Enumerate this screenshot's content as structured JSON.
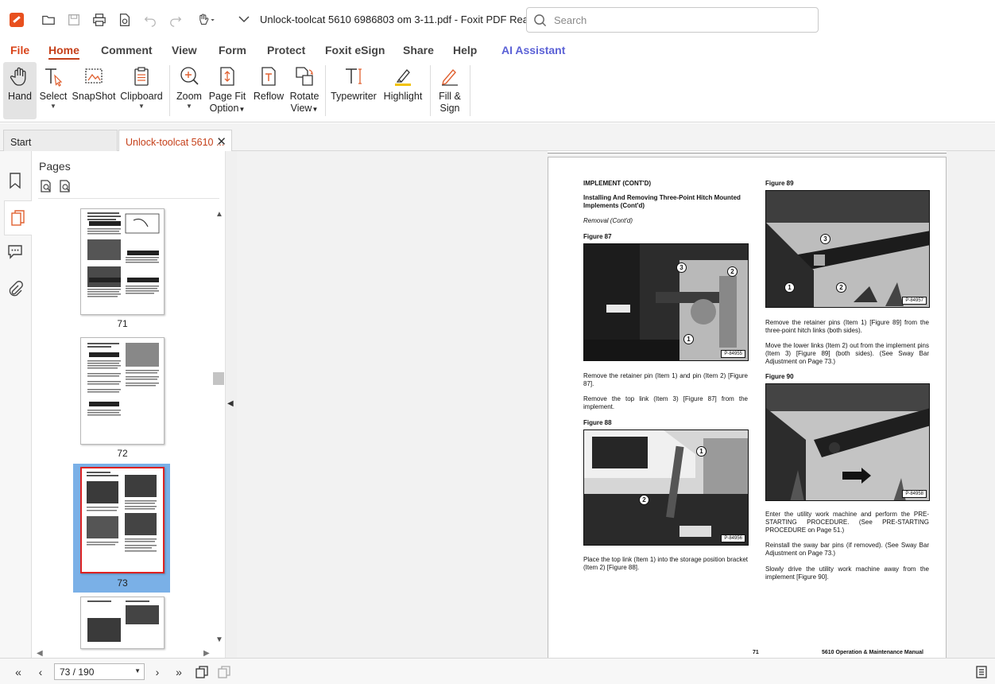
{
  "window": {
    "title": "Unlock-toolcat 5610 6986803 om 3-11.pdf - Foxit PDF Reader",
    "search_placeholder": "Search"
  },
  "quick_access": [
    "open-folder-icon",
    "save-icon",
    "print-icon",
    "print-preview-icon",
    "undo-icon",
    "redo-icon",
    "hand-dropdown-icon",
    "customize-icon"
  ],
  "menu": {
    "items": [
      "File",
      "Home",
      "Comment",
      "View",
      "Form",
      "Protect",
      "Foxit eSign",
      "Share",
      "Help",
      "AI Assistant"
    ],
    "active": "Home"
  },
  "ribbon": {
    "hand": "Hand",
    "select": "Select",
    "snapshot": "SnapShot",
    "clipboard": "Clipboard",
    "zoom": "Zoom",
    "page_fit_1": "Page Fit",
    "page_fit_2": "Option",
    "reflow": "Reflow",
    "rotate_1": "Rotate",
    "rotate_2": "View",
    "typewriter": "Typewriter",
    "highlight": "Highlight",
    "fill_sign_1": "Fill &",
    "fill_sign_2": "Sign"
  },
  "tabs": {
    "start": "Start",
    "document": "Unlock-toolcat 5610 ..."
  },
  "panel": {
    "title": "Pages",
    "thumbnails": [
      "71",
      "72",
      "73"
    ],
    "selected": "73"
  },
  "page": {
    "header_left": "IMPLEMENT (CONT'D)",
    "section_title": "Installing And Removing Three-Point Hitch Mounted Implements (Cont'd)",
    "subsection": "Removal (Cont'd)",
    "fig87_label": "Figure 87",
    "fig87_code": "P-84955",
    "para1": "Remove the retainer pin (Item 1) and pin (Item 2) [Figure 87].",
    "para2": "Remove the top link (Item 3) [Figure 87] from the implement.",
    "fig88_label": "Figure 88",
    "fig88_code": "P-84956",
    "para3": "Place the top link (Item 1) into the storage position bracket (Item 2) [Figure 88].",
    "fig89_label": "Figure 89",
    "fig89_code": "P-84957",
    "para4": "Remove the retainer pins (Item 1) [Figure 89] from the three-point hitch links (both sides).",
    "para5": "Move the lower links (Item 2) out from the implement pins (Item 3) [Figure 89] (both sides). (See Sway Bar Adjustment on Page 73.)",
    "fig90_label": "Figure 90",
    "fig90_code": "P-84958",
    "para6": "Enter the utility work machine and perform the PRE-STARTING PROCEDURE. (See PRE-STARTING PROCEDURE on Page 51.)",
    "para7": "Reinstall the sway bar pins (if removed). (See Sway Bar Adjustment on Page 73.)",
    "para8": "Slowly drive the utility work machine away from the implement [Figure 90].",
    "page_number": "71",
    "manual_title": "5610 Operation & Maintenance Manual",
    "callouts": {
      "c1": "1",
      "c2": "2",
      "c3": "3"
    }
  },
  "statusbar": {
    "page_indicator": "73 / 190"
  },
  "colors": {
    "accent": "#c5401a",
    "ai": "#5b61d6",
    "selection": "#7ab0e7"
  }
}
